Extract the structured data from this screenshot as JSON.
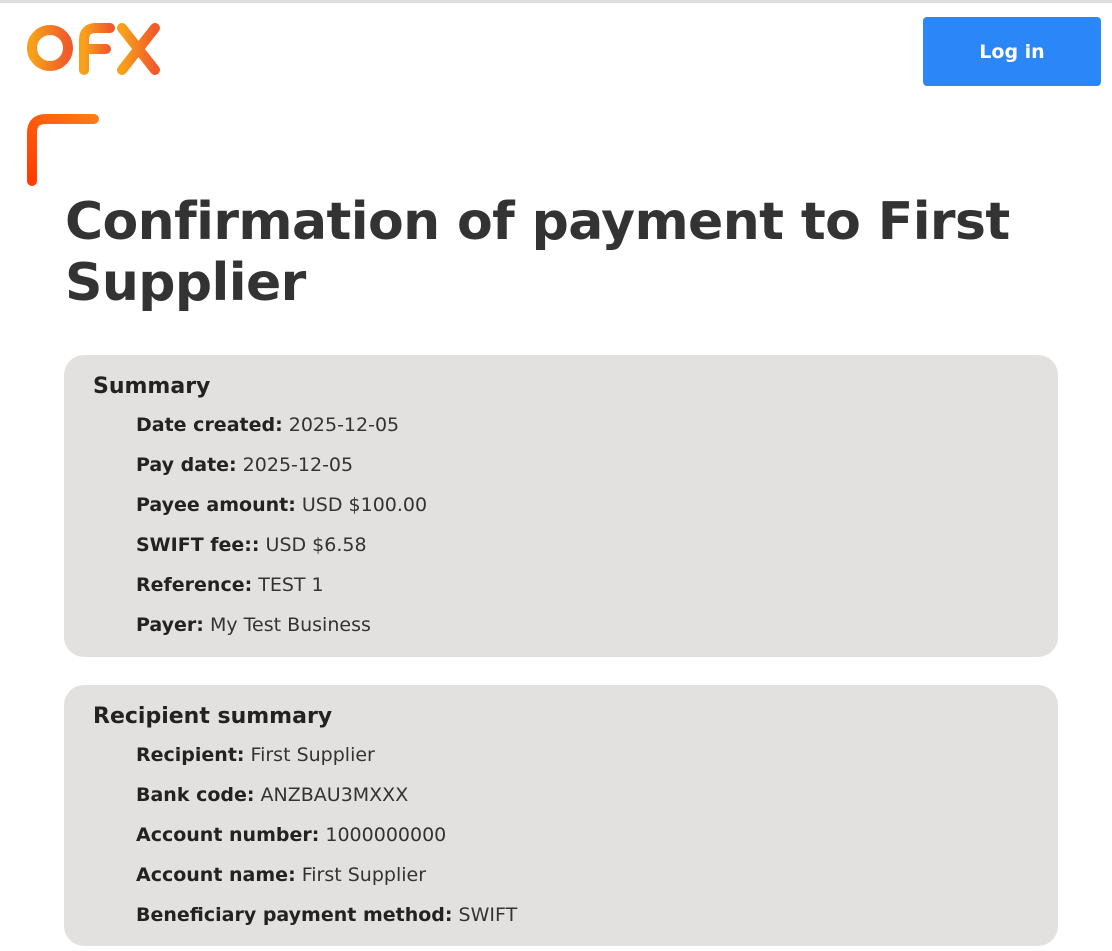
{
  "brand": {
    "logo_text": "OFX",
    "colors": {
      "logo_start": "#f7a11a",
      "logo_end": "#f15a29",
      "accent": "#ff4f1a",
      "primary_button": "#2b87f7",
      "card_background": "#e3e1e0"
    }
  },
  "header": {
    "login_label": "Log in"
  },
  "page": {
    "title": "Confirmation of payment to First Supplier"
  },
  "summary": {
    "title": "Summary",
    "rows": [
      {
        "label": "Date created:",
        "value": " 2025-12-05"
      },
      {
        "label": "Pay date:",
        "value": " 2025-12-05"
      },
      {
        "label": "Payee amount:",
        "value": " USD $100.00"
      },
      {
        "label": "SWIFT fee::",
        "value": " USD $6.58"
      },
      {
        "label": "Reference:",
        "value": " TEST 1"
      },
      {
        "label": "Payer:",
        "value": " My Test Business"
      }
    ]
  },
  "recipient": {
    "title": "Recipient summary",
    "rows": [
      {
        "label": "Recipient:",
        "value": " First Supplier"
      },
      {
        "label": "Bank code:",
        "value": " ANZBAU3MXXX"
      },
      {
        "label": "Account number:",
        "value": " 1000000000"
      },
      {
        "label": "Account name:",
        "value": " First Supplier"
      },
      {
        "label": "Beneficiary payment method:",
        "value": " SWIFT"
      }
    ]
  }
}
